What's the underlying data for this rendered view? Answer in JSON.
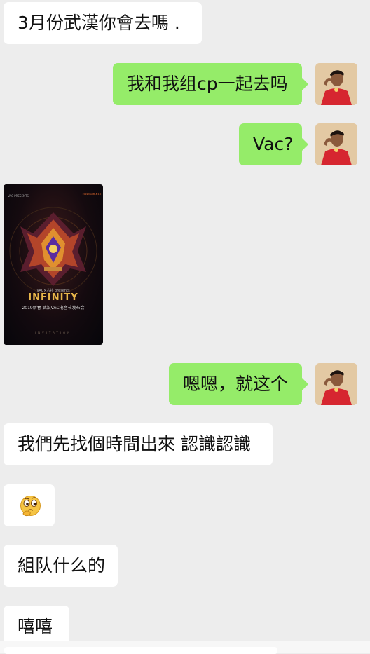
{
  "messages": [
    {
      "side": "left",
      "text": "3月份武漢你會去嗎 ."
    },
    {
      "side": "right",
      "text": "我和我组cp一起去吗"
    },
    {
      "side": "right",
      "text": "Vac?"
    },
    {
      "side": "left",
      "type": "image",
      "poster": {
        "header_left": "VAC PRESENTS",
        "header_right": "2019 MARBLE 2.0",
        "presents": "VAC×芯扑 presents",
        "title": "INFINITY",
        "subtitle": "2019新春 武汉VAC电音节发布会",
        "footer": "INVITATION"
      }
    },
    {
      "side": "right",
      "text": "嗯嗯，就这个"
    },
    {
      "side": "left",
      "text": "我們先找個時間出來 認識認識"
    },
    {
      "side": "left",
      "type": "emoji",
      "emoji": "thinking-face-emoji"
    },
    {
      "side": "left",
      "text": "組队什么的"
    },
    {
      "side": "left",
      "text": "嘻嘻"
    }
  ],
  "colors": {
    "background": "#ededed",
    "bubble_left": "#ffffff",
    "bubble_right": "#95ec69",
    "avatar_shirt": "#d62630"
  }
}
